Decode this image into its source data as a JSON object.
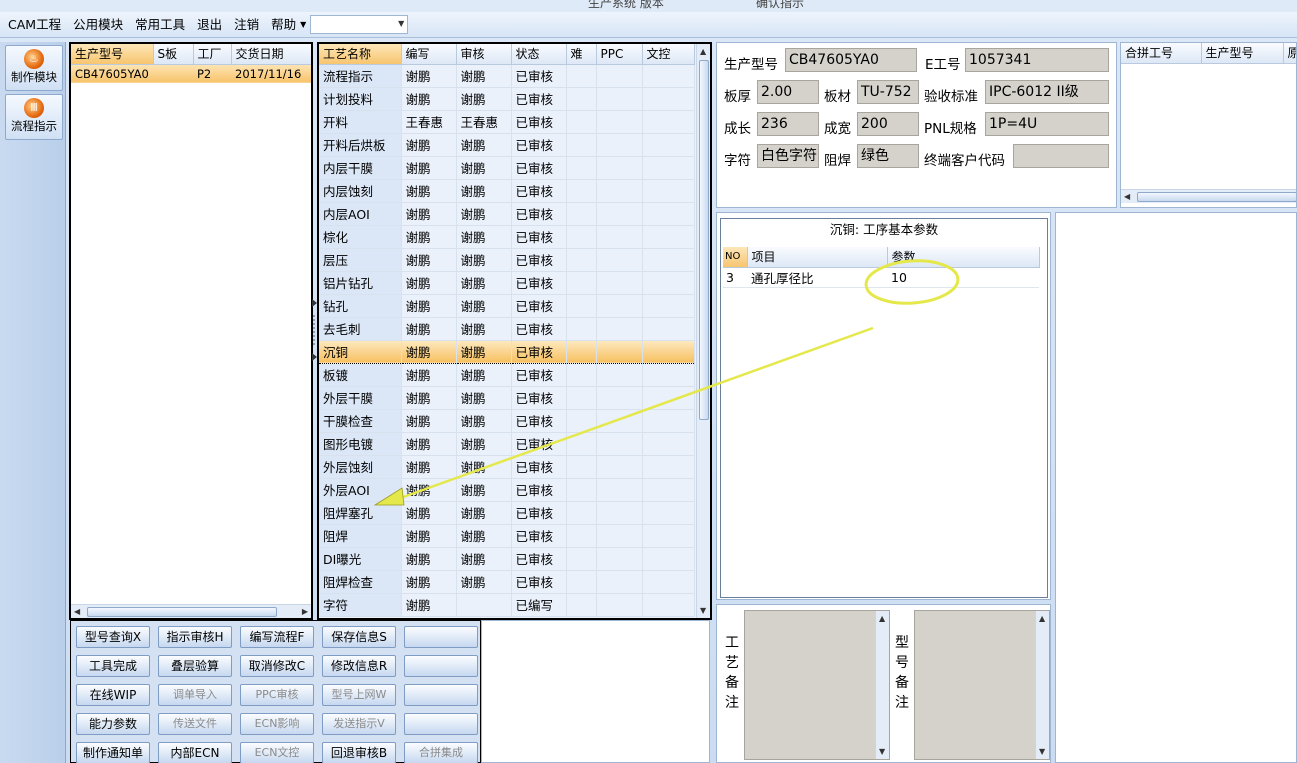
{
  "title_strip": {
    "left": "生产系统 版本",
    "right": "确认指示"
  },
  "menu": {
    "items": [
      "CAM工程",
      "公用模块",
      "常用工具",
      "退出",
      "注销",
      "帮助"
    ],
    "combo_value": ""
  },
  "toolbar": {
    "make_module": "制作模块",
    "flow_instruction": "流程指示"
  },
  "models": {
    "headers": [
      "生产型号",
      "S板",
      "工厂",
      "交货日期"
    ],
    "rows": [
      {
        "model": "CB47605YA0",
        "s": "",
        "factory": "P2",
        "date": "2017/11/16"
      }
    ]
  },
  "process": {
    "headers": [
      "工艺名称",
      "编写",
      "审核",
      "状态",
      "难",
      "PPC",
      "文控"
    ],
    "rows": [
      {
        "name": "流程指示",
        "writer": "谢鹏",
        "auditor": "谢鹏",
        "status": "已审核"
      },
      {
        "name": "计划投料",
        "writer": "谢鹏",
        "auditor": "谢鹏",
        "status": "已审核"
      },
      {
        "name": "开料",
        "writer": "王春惠",
        "auditor": "王春惠",
        "status": "已审核"
      },
      {
        "name": "开料后烘板",
        "writer": "谢鹏",
        "auditor": "谢鹏",
        "status": "已审核"
      },
      {
        "name": "内层干膜",
        "writer": "谢鹏",
        "auditor": "谢鹏",
        "status": "已审核"
      },
      {
        "name": "内层蚀刻",
        "writer": "谢鹏",
        "auditor": "谢鹏",
        "status": "已审核"
      },
      {
        "name": "内层AOI",
        "writer": "谢鹏",
        "auditor": "谢鹏",
        "status": "已审核"
      },
      {
        "name": "棕化",
        "writer": "谢鹏",
        "auditor": "谢鹏",
        "status": "已审核"
      },
      {
        "name": "层压",
        "writer": "谢鹏",
        "auditor": "谢鹏",
        "status": "已审核"
      },
      {
        "name": "铝片钻孔",
        "writer": "谢鹏",
        "auditor": "谢鹏",
        "status": "已审核"
      },
      {
        "name": "钻孔",
        "writer": "谢鹏",
        "auditor": "谢鹏",
        "status": "已审核"
      },
      {
        "name": "去毛刺",
        "writer": "谢鹏",
        "auditor": "谢鹏",
        "status": "已审核"
      },
      {
        "name": "沉铜",
        "writer": "谢鹏",
        "auditor": "谢鹏",
        "status": "已审核",
        "active": true
      },
      {
        "name": "板镀",
        "writer": "谢鹏",
        "auditor": "谢鹏",
        "status": "已审核"
      },
      {
        "name": "外层干膜",
        "writer": "谢鹏",
        "auditor": "谢鹏",
        "status": "已审核"
      },
      {
        "name": "干膜检查",
        "writer": "谢鹏",
        "auditor": "谢鹏",
        "status": "已审核"
      },
      {
        "name": "图形电镀",
        "writer": "谢鹏",
        "auditor": "谢鹏",
        "status": "已审核"
      },
      {
        "name": "外层蚀刻",
        "writer": "谢鹏",
        "auditor": "谢鹏",
        "status": "已审核"
      },
      {
        "name": "外层AOI",
        "writer": "谢鹏",
        "auditor": "谢鹏",
        "status": "已审核"
      },
      {
        "name": "阻焊塞孔",
        "writer": "谢鹏",
        "auditor": "谢鹏",
        "status": "已审核"
      },
      {
        "name": "阻焊",
        "writer": "谢鹏",
        "auditor": "谢鹏",
        "status": "已审核"
      },
      {
        "name": "DI曝光",
        "writer": "谢鹏",
        "auditor": "谢鹏",
        "status": "已审核"
      },
      {
        "name": "阻焊检查",
        "writer": "谢鹏",
        "auditor": "谢鹏",
        "status": "已审核"
      },
      {
        "name": "字符",
        "writer": "谢鹏",
        "auditor": "",
        "status": "已编写"
      }
    ]
  },
  "info": {
    "model_label": "生产型号",
    "model_value": "CB47605YA0",
    "eno_label": "E工号",
    "eno_value": "1057341",
    "thick_label": "板厚",
    "thick_value": "2.00",
    "material_label": "板材",
    "material_value": "TU-752",
    "standard_label": "验收标准",
    "standard_value": "IPC-6012 II级",
    "length_label": "成长",
    "length_value": "236",
    "width_label": "成宽",
    "width_value": "200",
    "pnl_label": "PNL规格",
    "pnl_value": "1P=4U",
    "char_label": "字符",
    "char_value": "白色字符",
    "mask_label": "阻焊",
    "mask_value": "绿色",
    "customer_label": "终端客户代码",
    "customer_value": ""
  },
  "combine": {
    "headers": [
      "合拼工号",
      "生产型号",
      "原"
    ]
  },
  "params": {
    "title": "沉铜: 工序基本参数",
    "headers": [
      "NO",
      "项目",
      "参数"
    ],
    "rows": [
      {
        "no": "3",
        "item": "通孔厚径比",
        "value": "10"
      }
    ]
  },
  "notes": {
    "process_label": "工艺备注",
    "model_label": "型号备注"
  },
  "buttons": [
    [
      "型号查询X",
      "指示审核H",
      "编写流程F",
      "保存信息S",
      ""
    ],
    [
      "工具完成",
      "叠层验算",
      "取消修改C",
      "修改信息R",
      ""
    ],
    [
      "在线WIP",
      "调单导入",
      "PPC审核",
      "型号上网W",
      ""
    ],
    [
      "能力参数",
      "传送文件",
      "ECN影响",
      "发送指示V",
      ""
    ],
    [
      "制作通知单",
      "内部ECN",
      "ECN文控",
      "回退审核B",
      "合拼集成"
    ]
  ],
  "buttons_disabled": [
    [
      false,
      false,
      false,
      false,
      false
    ],
    [
      false,
      false,
      false,
      false,
      false
    ],
    [
      false,
      true,
      true,
      true,
      false
    ],
    [
      false,
      true,
      true,
      true,
      false
    ],
    [
      false,
      false,
      true,
      false,
      true
    ]
  ],
  "colors": {
    "accent_orange": "#f7c36a",
    "annotation_yellow": "#e5e84a"
  }
}
